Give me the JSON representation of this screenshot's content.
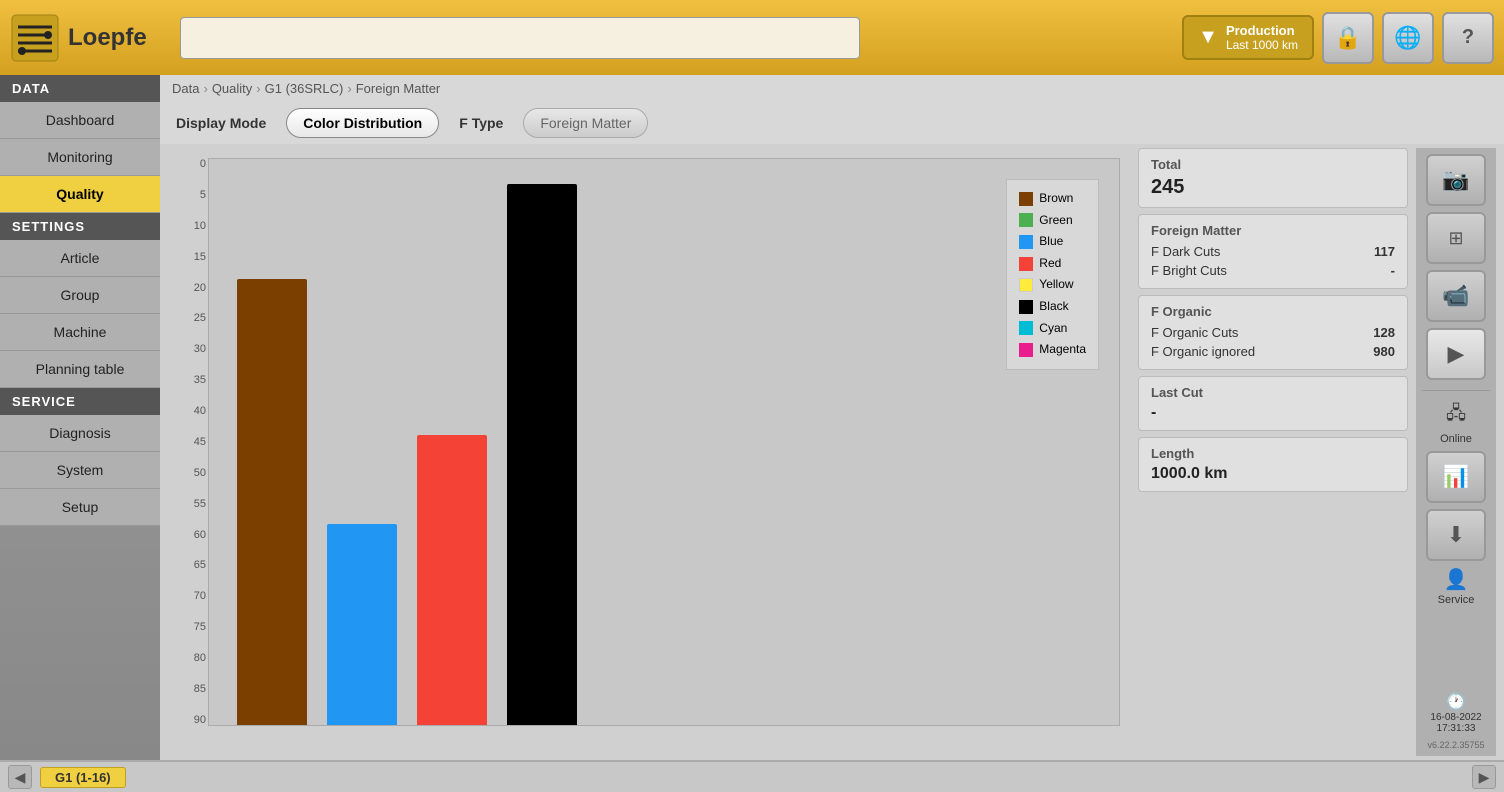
{
  "header": {
    "logo_text": "Loepfe",
    "search_placeholder": "",
    "production_label": "Production",
    "production_sublabel": "Last 1000 km",
    "lock_icon": "🔒",
    "globe_icon": "🌐",
    "help_icon": "?"
  },
  "sidebar": {
    "data_section": "DATA",
    "items_data": [
      {
        "label": "Dashboard",
        "active": false
      },
      {
        "label": "Monitoring",
        "active": false
      },
      {
        "label": "Quality",
        "active": true
      }
    ],
    "settings_section": "SETTINGS",
    "items_settings": [
      {
        "label": "Article",
        "active": false
      },
      {
        "label": "Group",
        "active": false
      },
      {
        "label": "Machine",
        "active": false
      },
      {
        "label": "Planning table",
        "active": false
      }
    ],
    "service_section": "SERVICE",
    "items_service": [
      {
        "label": "Diagnosis",
        "active": false
      },
      {
        "label": "System",
        "active": false
      },
      {
        "label": "Setup",
        "active": false
      }
    ]
  },
  "breadcrumb": {
    "items": [
      "Data",
      "Quality",
      "G1 (36SRLC)",
      "Foreign Matter"
    ]
  },
  "display_mode": {
    "label": "Display Mode",
    "active_btn": "Color Distribution",
    "ftype_label": "F Type",
    "ftype_btn": "Foreign Matter"
  },
  "chart": {
    "y_axis": [
      "0",
      "5",
      "10",
      "15",
      "20",
      "25",
      "30",
      "35",
      "40",
      "45",
      "50",
      "55",
      "60",
      "65",
      "70",
      "75",
      "80",
      "85",
      "90"
    ],
    "bars": [
      {
        "color": "#7B3F00",
        "height_pct": 80,
        "label": "Brown"
      },
      {
        "color": "#2196F3",
        "height_pct": 36,
        "label": "Blue"
      },
      {
        "color": "#F44336",
        "height_pct": 52,
        "label": "Red"
      },
      {
        "color": "#000000",
        "height_pct": 97,
        "label": "Black"
      }
    ],
    "legend": [
      {
        "label": "Brown",
        "color": "#7B3F00"
      },
      {
        "label": "Green",
        "color": "#4CAF50"
      },
      {
        "label": "Blue",
        "color": "#2196F3"
      },
      {
        "label": "Red",
        "color": "#F44336"
      },
      {
        "label": "Yellow",
        "color": "#FFEB3B"
      },
      {
        "label": "Black",
        "color": "#000000"
      },
      {
        "label": "Cyan",
        "color": "#00BCD4"
      },
      {
        "label": "Magenta",
        "color": "#E91E8C"
      }
    ]
  },
  "stats": {
    "total_label": "Total",
    "total_value": "245",
    "foreign_matter_label": "Foreign Matter",
    "f_dark_cuts_label": "F Dark Cuts",
    "f_dark_cuts_value": "117",
    "f_bright_cuts_label": "F Bright Cuts",
    "f_bright_cuts_value": "-",
    "f_organic_label": "F Organic",
    "f_organic_cuts_label": "F Organic Cuts",
    "f_organic_cuts_value": "128",
    "f_organic_ignored_label": "F Organic ignored",
    "f_organic_ignored_value": "980",
    "last_cut_label": "Last Cut",
    "last_cut_value": "-",
    "length_label": "Length",
    "length_value": "1000.0 km"
  },
  "right_panel": {
    "camera_icon": "📷",
    "expand_icon": "⊞",
    "video_icon": "📹",
    "play_icon": "▶",
    "chart_icon": "📊",
    "download_icon": "⬇",
    "online_label": "Online",
    "service_label": "Service",
    "datetime": "16-08-2022\n17:31:33",
    "version": "v6.22.2.35755"
  },
  "bottom_bar": {
    "left_arrow": "◀",
    "tab_label": "G1 (1-16)",
    "right_arrow": "▶"
  }
}
